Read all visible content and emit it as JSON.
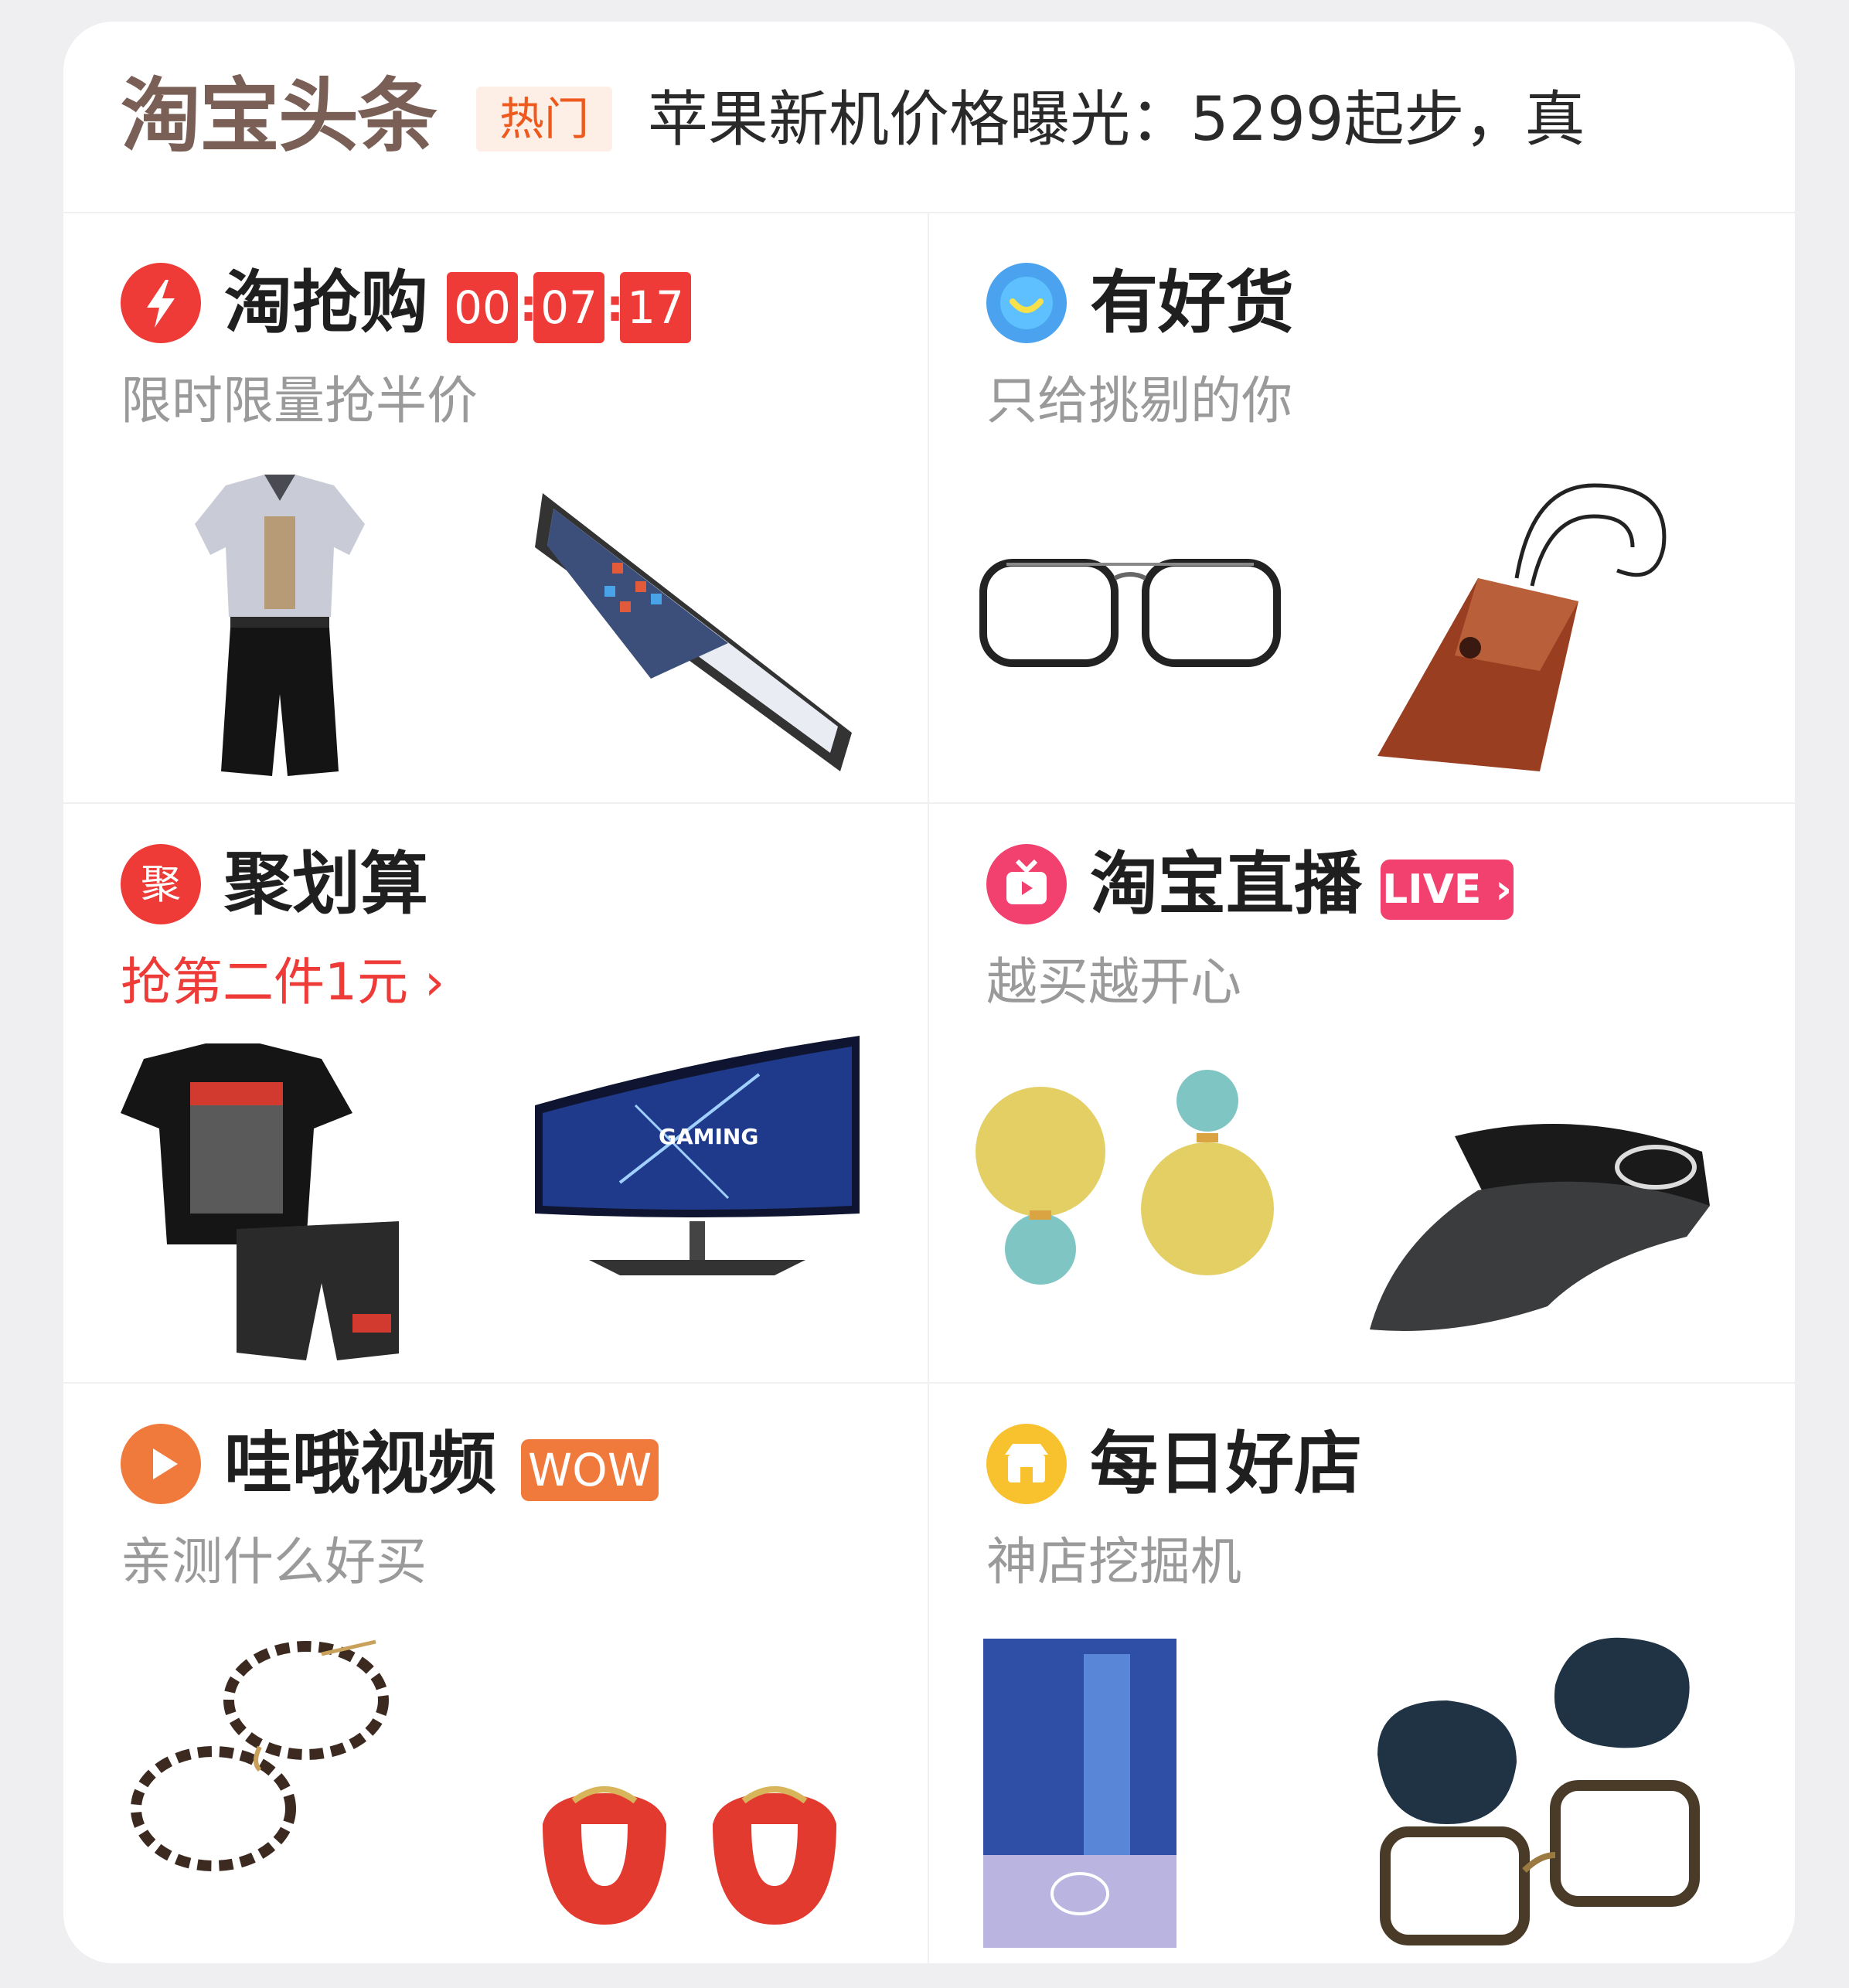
{
  "headline": {
    "brand": "淘宝头条",
    "tag": "热门",
    "text": "苹果新机价格曝光：5299起步，真"
  },
  "cells": {
    "qianggou": {
      "title": "淘抢购",
      "subtitle": "限时限量抢半价",
      "timer": [
        "00",
        "07",
        "17"
      ],
      "products": [
        "printed shirt and black shorts outfit",
        "tablet computer"
      ]
    },
    "haohuo": {
      "title": "有好货",
      "subtitle": "只给挑剔的你",
      "products": [
        "black frame eyeglasses",
        "leather glasses pouch with cord"
      ]
    },
    "juhuasuan": {
      "title": "聚划算",
      "icon_text": "聚",
      "subtitle": "抢第二件1元",
      "subtitle_arrow": "›",
      "products": [
        "black t-shirt and camo shorts set",
        "curved 100Hz gaming monitor"
      ]
    },
    "zhibo": {
      "title": "淘宝直播",
      "badge": "LIVE",
      "badge_arrow": "›",
      "subtitle": "越买越开心",
      "products": [
        "yellow and teal pearl earrings",
        "black sun visor cap"
      ]
    },
    "wow": {
      "title": "哇哦视频",
      "badge": "WOW",
      "subtitle": "亲测什么好买",
      "products": [
        "tortoiseshell round eyeglasses",
        "red hoop earrings"
      ]
    },
    "haodian": {
      "title": "每日好店",
      "subtitle": "神店挖掘机",
      "products": [
        "blue cleaning cloth package",
        "clip-on flip-up sunglasses"
      ]
    }
  },
  "colors": {
    "red": "#ee3b38",
    "blue": "#4ba3f0",
    "pink": "#f2416f",
    "orange": "#f07a3c",
    "yellow": "#f8c12e",
    "brand_brown": "#7a5f56",
    "gray_text": "#9a9a9a"
  },
  "icons": [
    "lightning-icon",
    "smile-icon",
    "ju-icon",
    "tv-icon",
    "play-icon",
    "shop-icon"
  ]
}
